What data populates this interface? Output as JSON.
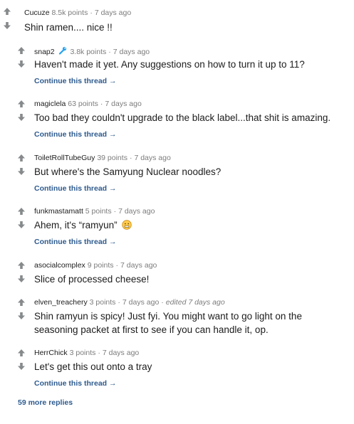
{
  "top": {
    "author": "Cucuze",
    "points": "8.5k points",
    "time": "7 days ago",
    "body": "Shin ramen.... nice !!"
  },
  "replies": [
    {
      "author": "snap2",
      "points": "3.8k points",
      "time": "7 days ago",
      "body": "Haven't made it yet. Any suggestions on how to turn it up to 11?",
      "continue": "Continue this thread"
    },
    {
      "author": "magiclela",
      "points": "63 points",
      "time": "7 days ago",
      "body": "Too bad they couldn't upgrade to the black label...that shit is amazing.",
      "continue": "Continue this thread"
    },
    {
      "author": "ToiletRollTubeGuy",
      "points": "39 points",
      "time": "7 days ago",
      "body": "But where's the Samyung Nuclear noodles?",
      "continue": "Continue this thread"
    },
    {
      "author": "funkmastamatt",
      "points": "5 points",
      "time": "7 days ago",
      "body": "Ahem, it's “ramyun”",
      "continue": "Continue this thread"
    },
    {
      "author": "asocialcomplex",
      "points": "9 points",
      "time": "7 days ago",
      "body": "Slice of processed cheese!"
    },
    {
      "author": "elven_treachery",
      "points": "3 points",
      "time": "7 days ago",
      "edited": "edited 7 days ago",
      "body_line1": "Shin ramyun is spicy! Just fyi. You might want to go light on the",
      "body_line2": "seasoning packet at first to see if you can handle it, op."
    },
    {
      "author": "HerrChick",
      "points": "3 points",
      "time": "7 days ago",
      "body": "Let's get this out onto a tray",
      "continue": "Continue this thread"
    }
  ],
  "more_replies": "59 more replies",
  "colors": {
    "arrow": "#878a8c",
    "link": "#2d5a8e",
    "meta": "#7c7c7c",
    "flair": "#24a0ed",
    "emoji": "#ffcc4d"
  },
  "icons": {
    "upvote": "up-arrow-icon",
    "downvote": "down-arrow-icon",
    "flair": "wrench-icon",
    "emoji": "grimace-emoji-icon"
  }
}
